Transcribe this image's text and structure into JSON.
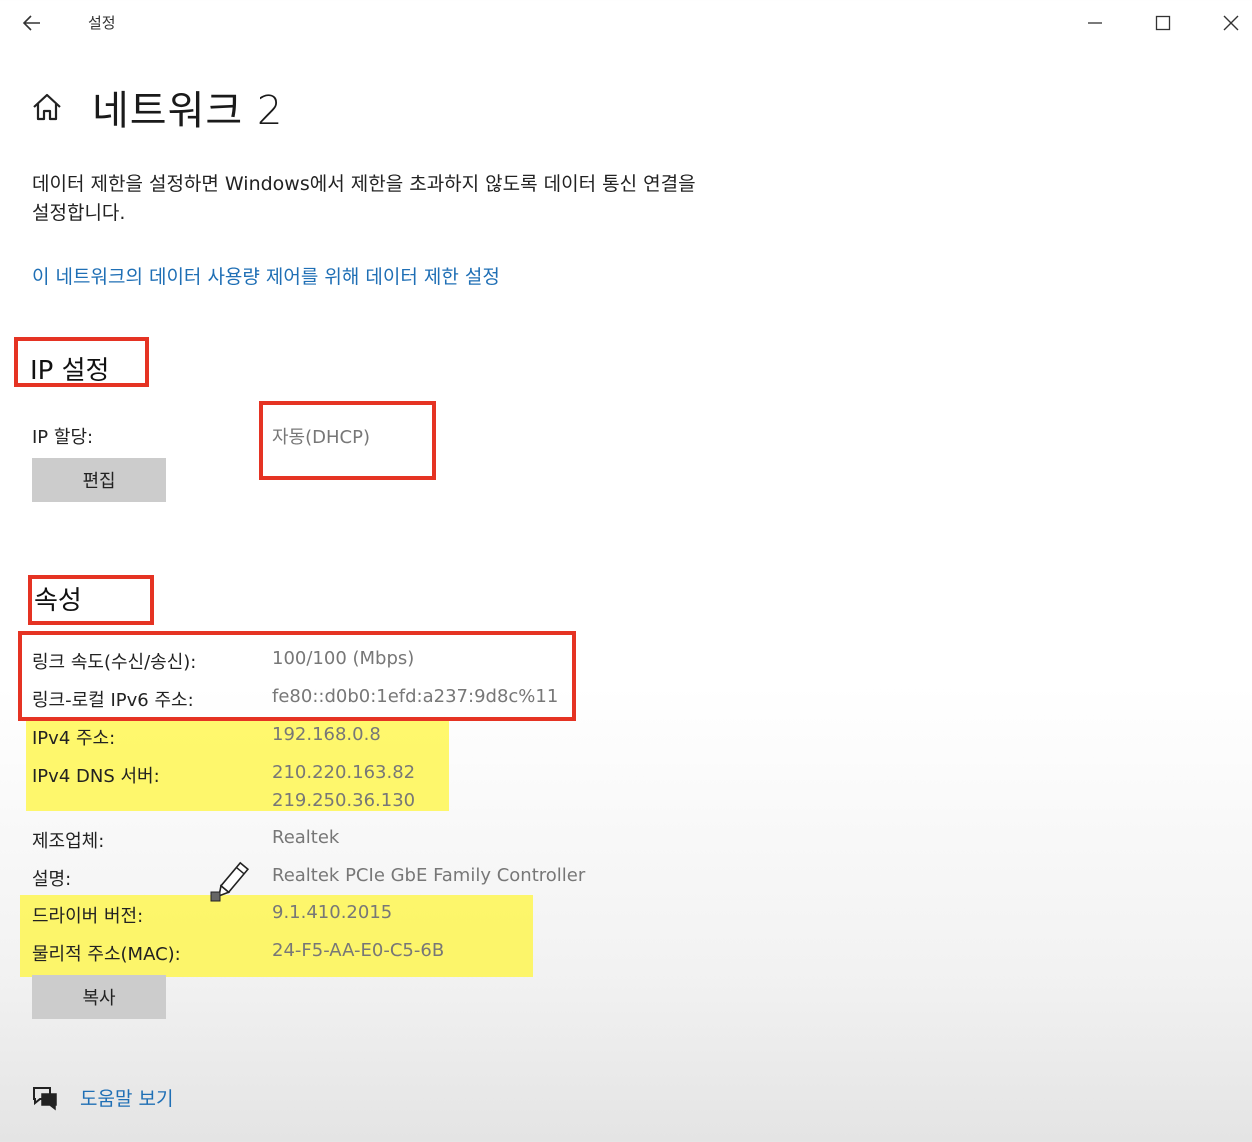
{
  "window": {
    "app_title": "설정",
    "back_icon": "arrow-left-icon",
    "minimize_icon": "minimize-icon",
    "maximize_icon": "maximize-icon",
    "close_icon": "close-icon"
  },
  "header": {
    "home_icon": "home-icon",
    "title": "네트워크 2"
  },
  "data_limit": {
    "description": "데이터 제한을 설정하면 Windows에서 제한을 초과하지 않도록 데이터 통신 연결을 설정합니다.",
    "link": "이 네트워크의 데이터 사용량 제어를 위해 데이터 제한 설정"
  },
  "ip_settings": {
    "heading": "IP 설정",
    "assignment_label": "IP 할당:",
    "assignment_value": "자동(DHCP)",
    "edit_button": "편집"
  },
  "properties": {
    "heading": "속성",
    "link_speed_label": "링크 속도(수신/송신):",
    "link_speed_value": "100/100 (Mbps)",
    "ipv6_label": "링크-로컬 IPv6 주소:",
    "ipv6_value": "fe80::d0b0:1efd:a237:9d8c%11",
    "ipv4_label": "IPv4 주소:",
    "ipv4_value": "192.168.0.8",
    "dns_label": "IPv4 DNS 서버:",
    "dns_value_1": "210.220.163.82",
    "dns_value_2": "219.250.36.130",
    "manufacturer_label": "제조업체:",
    "manufacturer_value": "Realtek",
    "description_label": "설명:",
    "description_value": "Realtek PCIe GbE Family Controller",
    "driver_label": "드라이버 버전:",
    "driver_value": "9.1.410.2015",
    "mac_label": "물리적 주소(MAC):",
    "mac_value": "24-F5-AA-E0-C5-6B",
    "copy_button": "복사"
  },
  "footer": {
    "help_icon": "help-chat-icon",
    "help_link": "도움말 보기"
  },
  "colors": {
    "accent": "#1f6fb5",
    "annotation_red": "#e53323",
    "annotation_yellow": "#fff53c",
    "button_gray": "#cccccc"
  }
}
